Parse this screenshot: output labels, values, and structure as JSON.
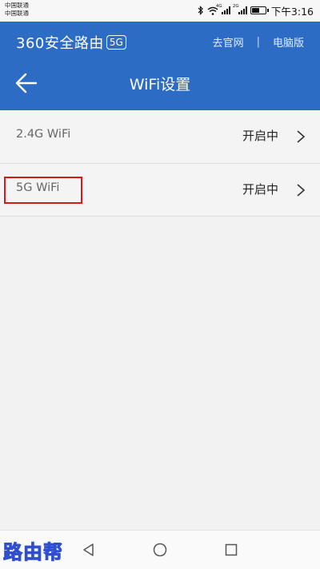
{
  "status_bar": {
    "carrier_1": "中国联通",
    "carrier_2": "中国联通",
    "network_1": "4G",
    "network_2": "2G",
    "battery_level": 0.6,
    "time": "下午3:16"
  },
  "header": {
    "brand_name": "360安全路由",
    "brand_badge": "5G",
    "link_official_site": "去官网",
    "link_separator": "|",
    "link_desktop": "电脑版",
    "page_title": "WiFi设置",
    "back_icon": "arrow-left-icon"
  },
  "wifi_list": [
    {
      "label": "2.4G WiFi",
      "status": "开启中"
    },
    {
      "label": "5G WiFi",
      "status": "开启中"
    }
  ],
  "nav_bar": {
    "back_icon": "triangle-back-icon",
    "home_icon": "circle-home-icon",
    "recents_icon": "square-recents-icon"
  },
  "watermark": "路由帮",
  "colors": {
    "header_bg": "#2d6cc4",
    "highlight_border": "#d21a1a"
  }
}
